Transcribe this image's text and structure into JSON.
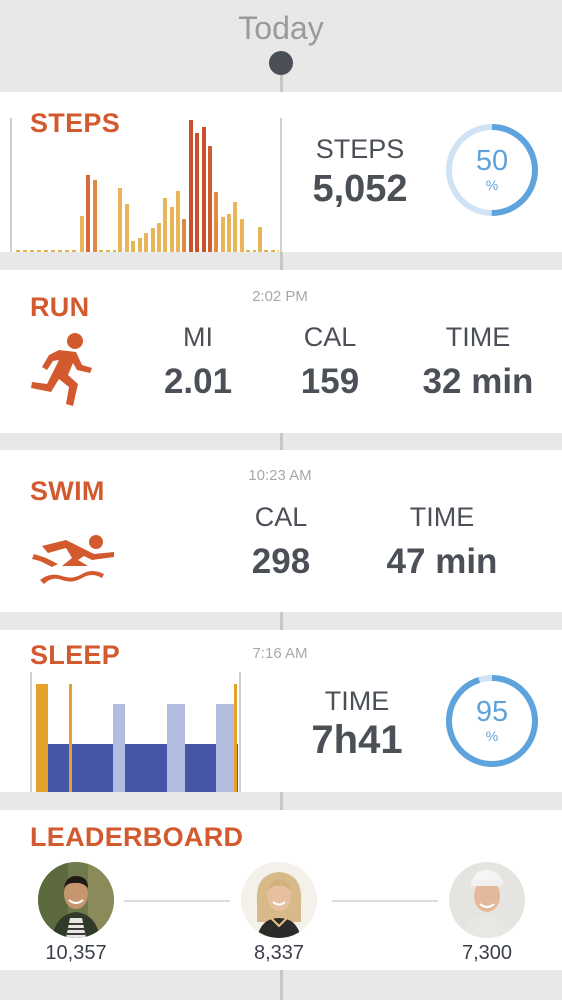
{
  "header": {
    "title": "Today"
  },
  "steps": {
    "title": "STEPS",
    "stat_label": "STEPS",
    "stat_value": "5,052",
    "percent": 50,
    "percent_label": "50",
    "percent_symbol": "%"
  },
  "run": {
    "title": "RUN",
    "time": "2:02 PM",
    "mi_label": "MI",
    "mi_value": "2.01",
    "cal_label": "CAL",
    "cal_value": "159",
    "time_label": "TIME",
    "time_value": "32 min"
  },
  "swim": {
    "title": "SWIM",
    "time": "10:23 AM",
    "cal_label": "CAL",
    "cal_value": "298",
    "time_label": "TIME",
    "time_value": "47 min"
  },
  "sleep": {
    "title": "SLEEP",
    "time": "7:16 AM",
    "time_label": "TIME",
    "time_value": "7h41",
    "percent": 95,
    "percent_label": "95",
    "percent_symbol": "%"
  },
  "leaderboard": {
    "title": "LEADERBOARD",
    "entries": [
      {
        "score": "10,357"
      },
      {
        "score": "8,337"
      },
      {
        "score": "7,300"
      }
    ]
  },
  "colors": {
    "accent": "#d35a2e",
    "ring": "#5fa3dc",
    "sleep_deep": "#4556a6",
    "sleep_light": "#b2bde0",
    "sleep_awake": "#e5a22b"
  }
}
